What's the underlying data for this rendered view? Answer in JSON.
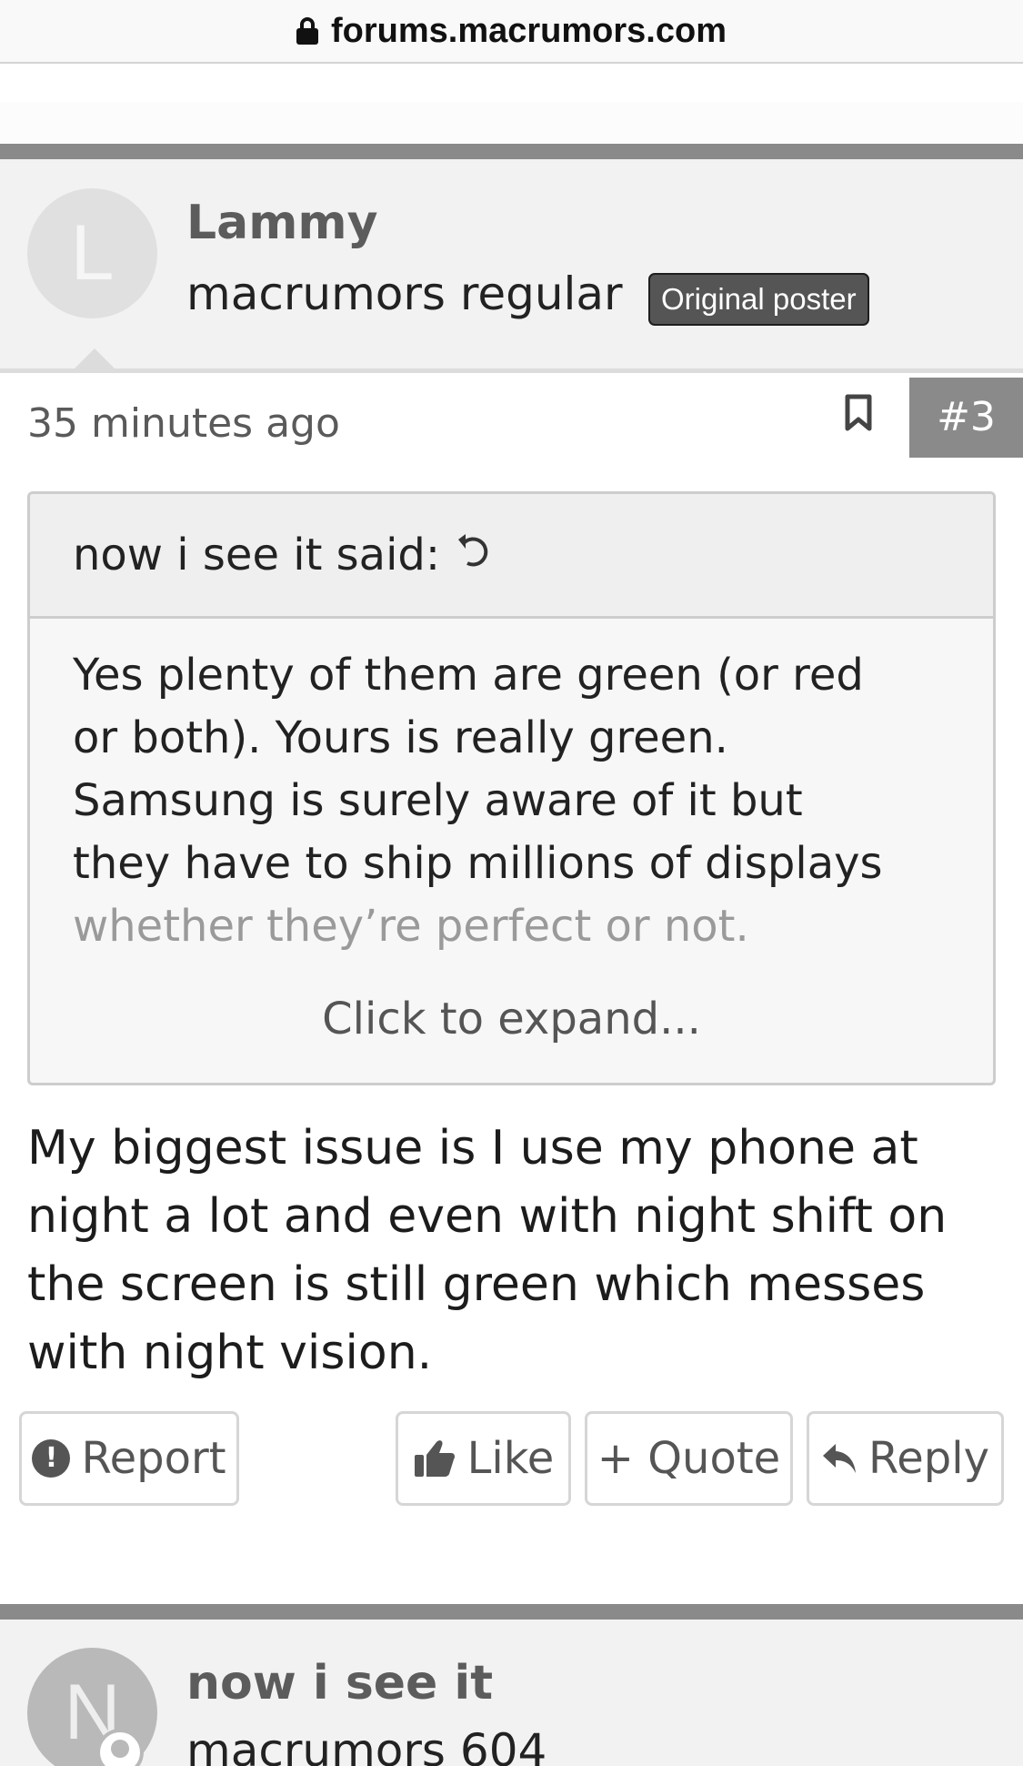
{
  "browser": {
    "url": "forums.macrumors.com"
  },
  "post": {
    "author": "Lammy",
    "avatar_letter": "L",
    "user_title": "macrumors regular",
    "badge": "Original poster",
    "time": "35 minutes ago",
    "number": "#3",
    "quote": {
      "author_label": "now i see it said:",
      "lines": [
        "Yes plenty of them are green (or red",
        "or both). Yours is really green.",
        "Samsung is surely aware of it but",
        "they have to ship millions of displays",
        "whether they’re perfect or not."
      ],
      "expand_label": "Click to expand..."
    },
    "message_lines": [
      "My biggest issue is I use my phone at",
      "night a lot and even with night shift on",
      "the screen is still green which messes",
      "with night vision."
    ],
    "actions": {
      "report": "Report",
      "like": "Like",
      "quote": "+ Quote",
      "reply": "Reply"
    }
  },
  "next_post": {
    "author": "now i see it",
    "avatar_letter": "N",
    "user_title": "macrumors 604"
  }
}
